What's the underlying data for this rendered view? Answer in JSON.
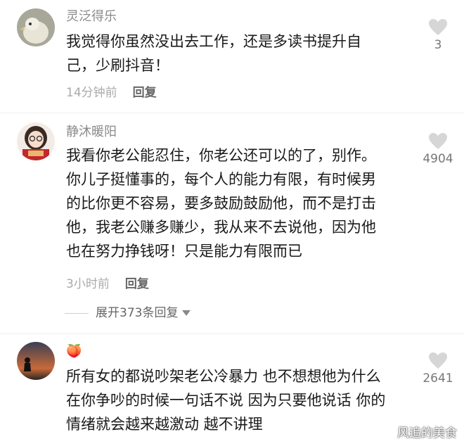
{
  "comments": [
    {
      "username": "灵泛得乐",
      "lines": [
        "我觉得你虽然没出去工作，还是多读书提升自",
        "己，少刷抖音！"
      ],
      "time": "14分钟前",
      "reply_label": "回复",
      "likes": "3"
    },
    {
      "username": "静沐暖阳",
      "lines": [
        "我看你老公能忍住，你老公还可以的了，别作。",
        "你儿子挺懂事的，每个人的能力有限，有时候男",
        "的比你更不容易，要多鼓励鼓励他，而不是打击",
        "他，我老公赚多赚少，我从来不去说他，因为他",
        "也在努力挣钱呀！只是能力有限而已"
      ],
      "time": "3小时前",
      "reply_label": "回复",
      "likes": "4904"
    },
    {
      "username": "🍑",
      "lines": [
        "所有女的都说吵架老公冷暴力 也不想想他为什么",
        "在你争吵的时候一句话不说 因为只要他说话 你的",
        "情绪就会越来越激动 越不讲理"
      ],
      "likes": "2641"
    }
  ],
  "expand_replies": "展开373条回复",
  "watermark": "风追的美食"
}
